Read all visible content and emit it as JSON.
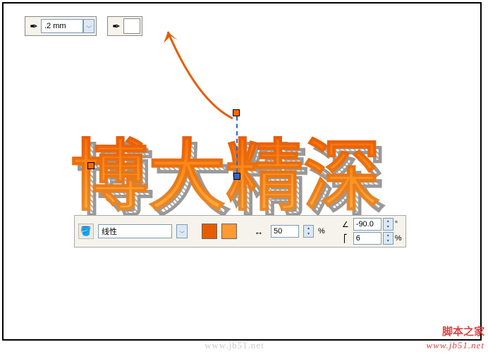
{
  "top": {
    "width_value": ".2 mm"
  },
  "bottom": {
    "fill_type": "线性",
    "midpoint": "50",
    "angle": "-90.0",
    "edge_pad": "6"
  },
  "main_text": "博大精深",
  "watermarks": {
    "center": "www.jb51.net",
    "brand": "脚本之家",
    "url": "www.jb51.net"
  },
  "labels": {
    "percent": "%",
    "degree": "°"
  }
}
